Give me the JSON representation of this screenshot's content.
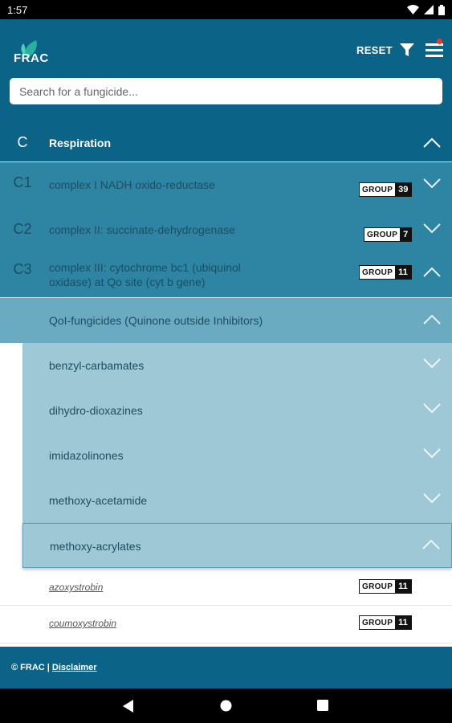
{
  "status": {
    "time": "1:57"
  },
  "header": {
    "logo_text": "FRAC",
    "reset_label": "RESET",
    "search_placeholder": "Search for a fungicide..."
  },
  "section": {
    "code": "C",
    "title": "Respiration"
  },
  "subsections": [
    {
      "code": "C1",
      "title": "complex I NADH oxido-reductase",
      "group": "39",
      "expanded": false
    },
    {
      "code": "C2",
      "title": "complex II: succinate-dehydrogenase",
      "group": "7",
      "expanded": false
    },
    {
      "code": "C3",
      "title_line1": "complex III: cytochrome bc1 (ubiquinol",
      "title_line2": "oxidase) at Qo site (cyt b gene)",
      "group": "11",
      "expanded": true
    }
  ],
  "group_name": "QoI-fungicides (Quinone outside Inhibitors)",
  "chemical_groups": [
    "benzyl-carbamates",
    "dihydro-dioxazines",
    "imidazolinones",
    "methoxy-acetamide",
    "methoxy-acrylates"
  ],
  "group_badge_label": "GROUP",
  "active_ingredients": [
    {
      "name": "azoxystrobin",
      "group": "11"
    },
    {
      "name": "coumoxystrobin",
      "group": "11"
    }
  ],
  "footer": {
    "copyright": "© FRAC |",
    "disclaimer": "Disclaimer"
  },
  "colors": {
    "header": "#0b6487",
    "level1": "#2d84a3",
    "level2": "#6aabc2",
    "level3": "#9ec8d6"
  }
}
